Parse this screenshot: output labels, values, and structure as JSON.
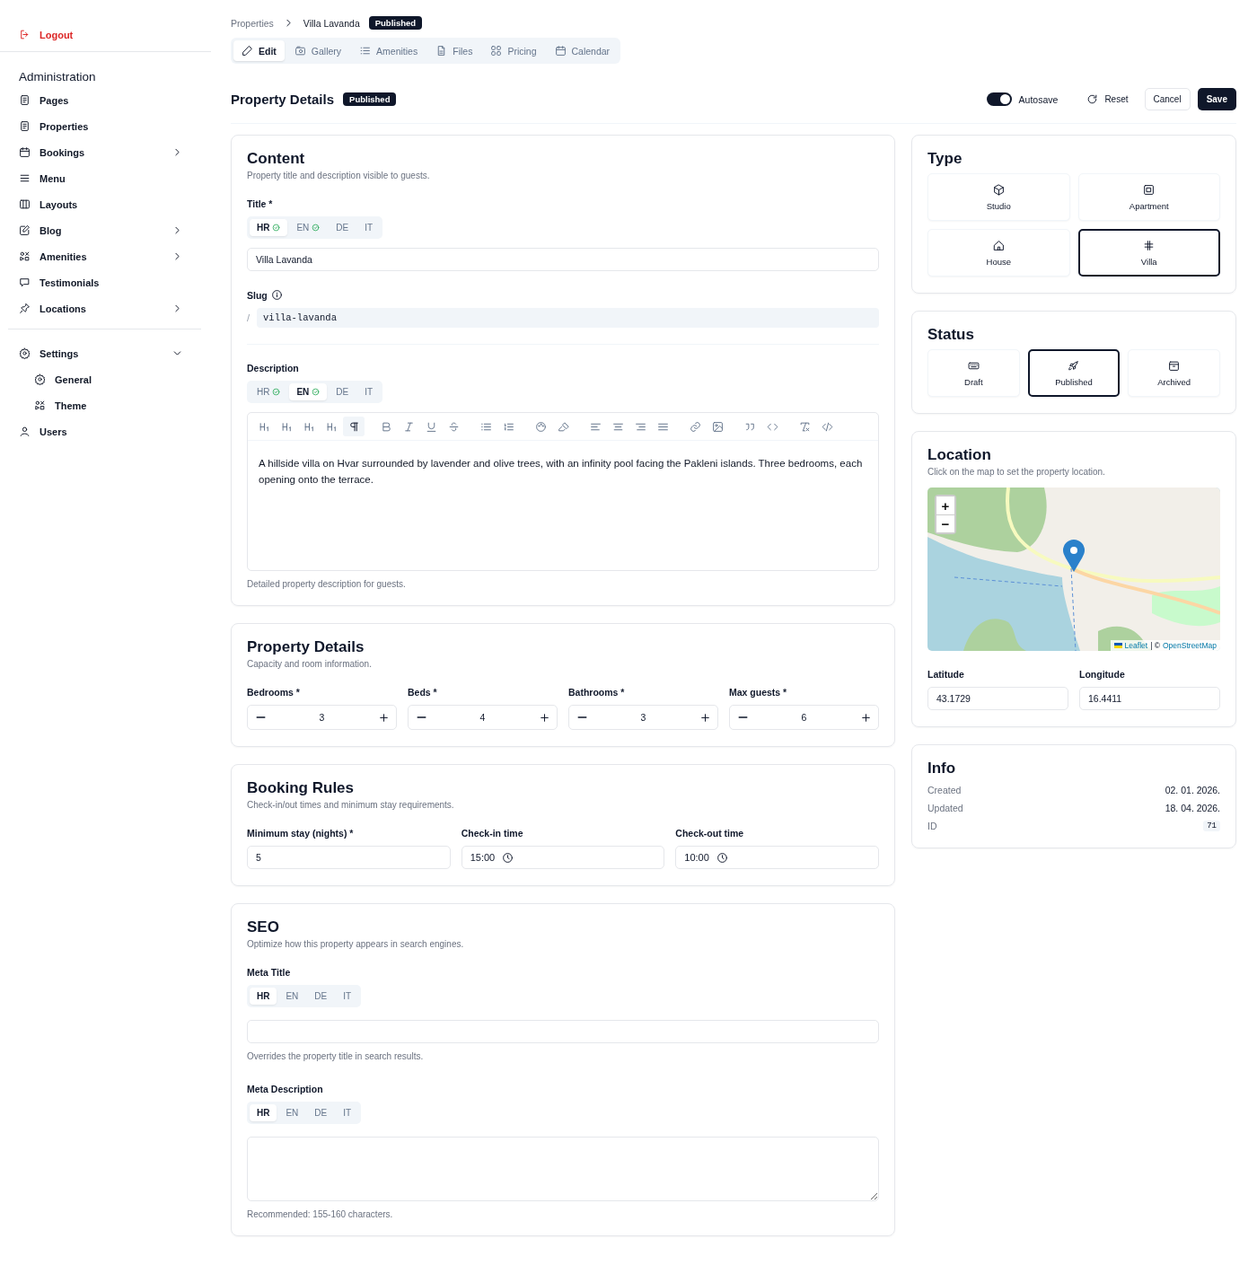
{
  "sidebar": {
    "logout": "Logout",
    "heading": "Administration",
    "groups": [
      [
        {
          "label": "Pages",
          "expandable": false
        },
        {
          "label": "Properties",
          "expandable": false
        },
        {
          "label": "Bookings",
          "expandable": true,
          "expanded": false
        },
        {
          "label": "Menu",
          "expandable": false
        },
        {
          "label": "Layouts",
          "expandable": false
        },
        {
          "label": "Blog",
          "expandable": true,
          "expanded": false
        },
        {
          "label": "Amenities",
          "expandable": true,
          "expanded": false
        },
        {
          "label": "Testimonials",
          "expandable": false
        },
        {
          "label": "Locations",
          "expandable": true,
          "expanded": false
        }
      ],
      [
        {
          "label": "Settings",
          "expandable": true,
          "expanded": true,
          "children": [
            {
              "label": "General"
            },
            {
              "label": "Theme"
            }
          ]
        },
        {
          "label": "Users",
          "expandable": false
        }
      ]
    ]
  },
  "breadcrumb": {
    "items": [
      "Properties",
      "Villa Lavanda"
    ],
    "badge": "Published"
  },
  "tabs": [
    {
      "label": "Edit",
      "selected": true
    },
    {
      "label": "Gallery",
      "selected": false
    },
    {
      "label": "Amenities",
      "selected": false
    },
    {
      "label": "Files",
      "selected": false
    },
    {
      "label": "Pricing",
      "selected": false
    },
    {
      "label": "Calendar",
      "selected": false
    }
  ],
  "header": {
    "title": "Property Details",
    "badge": "Published",
    "autosave": {
      "label": "Autosave",
      "on": true
    },
    "buttons": [
      {
        "label": "Reset",
        "kind": "ghost"
      },
      {
        "label": "Cancel",
        "kind": "outline"
      },
      {
        "label": "Save",
        "kind": "primary"
      }
    ]
  },
  "content": {
    "title": "Content",
    "subtitle": "Property title and description visible to guests.",
    "title_field": {
      "label": "Title *",
      "langs": [
        {
          "code": "HR",
          "selected": true,
          "done": true
        },
        {
          "code": "EN",
          "selected": false,
          "done": true
        },
        {
          "code": "DE",
          "selected": false,
          "done": false
        },
        {
          "code": "IT",
          "selected": false,
          "done": false
        }
      ],
      "value": "Villa Lavanda"
    },
    "slug": {
      "label": "Slug",
      "prefix": "/",
      "value": "villa-lavanda"
    },
    "description": {
      "label": "Description",
      "langs": [
        {
          "code": "HR",
          "selected": false,
          "done": true
        },
        {
          "code": "EN",
          "selected": true,
          "done": true
        },
        {
          "code": "DE",
          "selected": false,
          "done": false
        },
        {
          "code": "IT",
          "selected": false,
          "done": false
        }
      ],
      "toolbar": [
        {
          "selected": false
        },
        {
          "selected": false
        },
        {
          "selected": false
        },
        {
          "selected": false
        },
        {
          "selected": true
        },
        {
          "selected": false
        },
        {
          "selected": false
        },
        {
          "selected": false
        },
        {
          "selected": false
        },
        {
          "selected": false
        },
        {
          "selected": false
        },
        {
          "selected": false
        },
        {
          "selected": false
        },
        {
          "selected": false
        },
        {
          "selected": false
        },
        {
          "selected": false
        },
        {
          "selected": false
        },
        {
          "selected": false
        },
        {
          "selected": false
        },
        {
          "selected": false
        },
        {
          "selected": false
        },
        {
          "selected": false
        },
        {
          "selected": false
        }
      ],
      "text": "A hillside villa on Hvar surrounded by lavender and olive trees, with an infinity pool facing the Pakleni islands. Three bedrooms, each opening onto the terrace.",
      "hint": "Detailed property description for guests."
    }
  },
  "details": {
    "title": "Property Details",
    "subtitle": "Capacity and room information.",
    "fields": [
      {
        "label": "Bedrooms *",
        "value": "3"
      },
      {
        "label": "Beds *",
        "value": "4"
      },
      {
        "label": "Bathrooms *",
        "value": "3"
      },
      {
        "label": "Max guests *",
        "value": "6"
      }
    ]
  },
  "booking": {
    "title": "Booking Rules",
    "subtitle": "Check-in/out times and minimum stay requirements.",
    "fields": [
      {
        "label": "Minimum stay (nights) *",
        "value": "5",
        "kind": "number"
      },
      {
        "label": "Check-in time",
        "value": "15:00",
        "kind": "time"
      },
      {
        "label": "Check-out time",
        "value": "10:00",
        "kind": "time"
      }
    ]
  },
  "seo": {
    "title": "SEO",
    "subtitle": "Optimize how this property appears in search engines.",
    "meta_title": {
      "label": "Meta Title",
      "langs": [
        {
          "code": "HR",
          "selected": true
        },
        {
          "code": "EN",
          "selected": false
        },
        {
          "code": "DE",
          "selected": false
        },
        {
          "code": "IT",
          "selected": false
        }
      ],
      "hint": "Overrides the property title in search results."
    },
    "meta_description": {
      "label": "Meta Description",
      "langs": [
        {
          "code": "HR",
          "selected": true
        },
        {
          "code": "EN",
          "selected": false
        },
        {
          "code": "DE",
          "selected": false
        },
        {
          "code": "IT",
          "selected": false
        }
      ],
      "hint": "Recommended: 155-160 characters."
    }
  },
  "type": {
    "title": "Type",
    "options": [
      {
        "label": "Studio",
        "selected": false
      },
      {
        "label": "Apartment",
        "selected": false
      },
      {
        "label": "House",
        "selected": false
      },
      {
        "label": "Villa",
        "selected": true
      }
    ]
  },
  "status": {
    "title": "Status",
    "options": [
      {
        "label": "Draft",
        "selected": false
      },
      {
        "label": "Published",
        "selected": true
      },
      {
        "label": "Archived",
        "selected": false
      }
    ]
  },
  "location": {
    "title": "Location",
    "subtitle": "Click on the map to set the property location.",
    "map": {
      "zoom_in": "+",
      "zoom_out": "−",
      "attribution": {
        "links": [
          "Leaflet",
          "OpenStreetMap"
        ],
        "separator": "| ©"
      }
    },
    "fields": [
      {
        "label": "Latitude",
        "value": "43.1729"
      },
      {
        "label": "Longitude",
        "value": "16.4411"
      }
    ]
  },
  "info": {
    "title": "Info",
    "rows": [
      {
        "label": "Created",
        "value": "02. 01. 2026.",
        "kind": "text"
      },
      {
        "label": "Updated",
        "value": "18. 04. 2026.",
        "kind": "text"
      },
      {
        "label": "ID",
        "value": "71",
        "kind": "badge"
      }
    ]
  }
}
